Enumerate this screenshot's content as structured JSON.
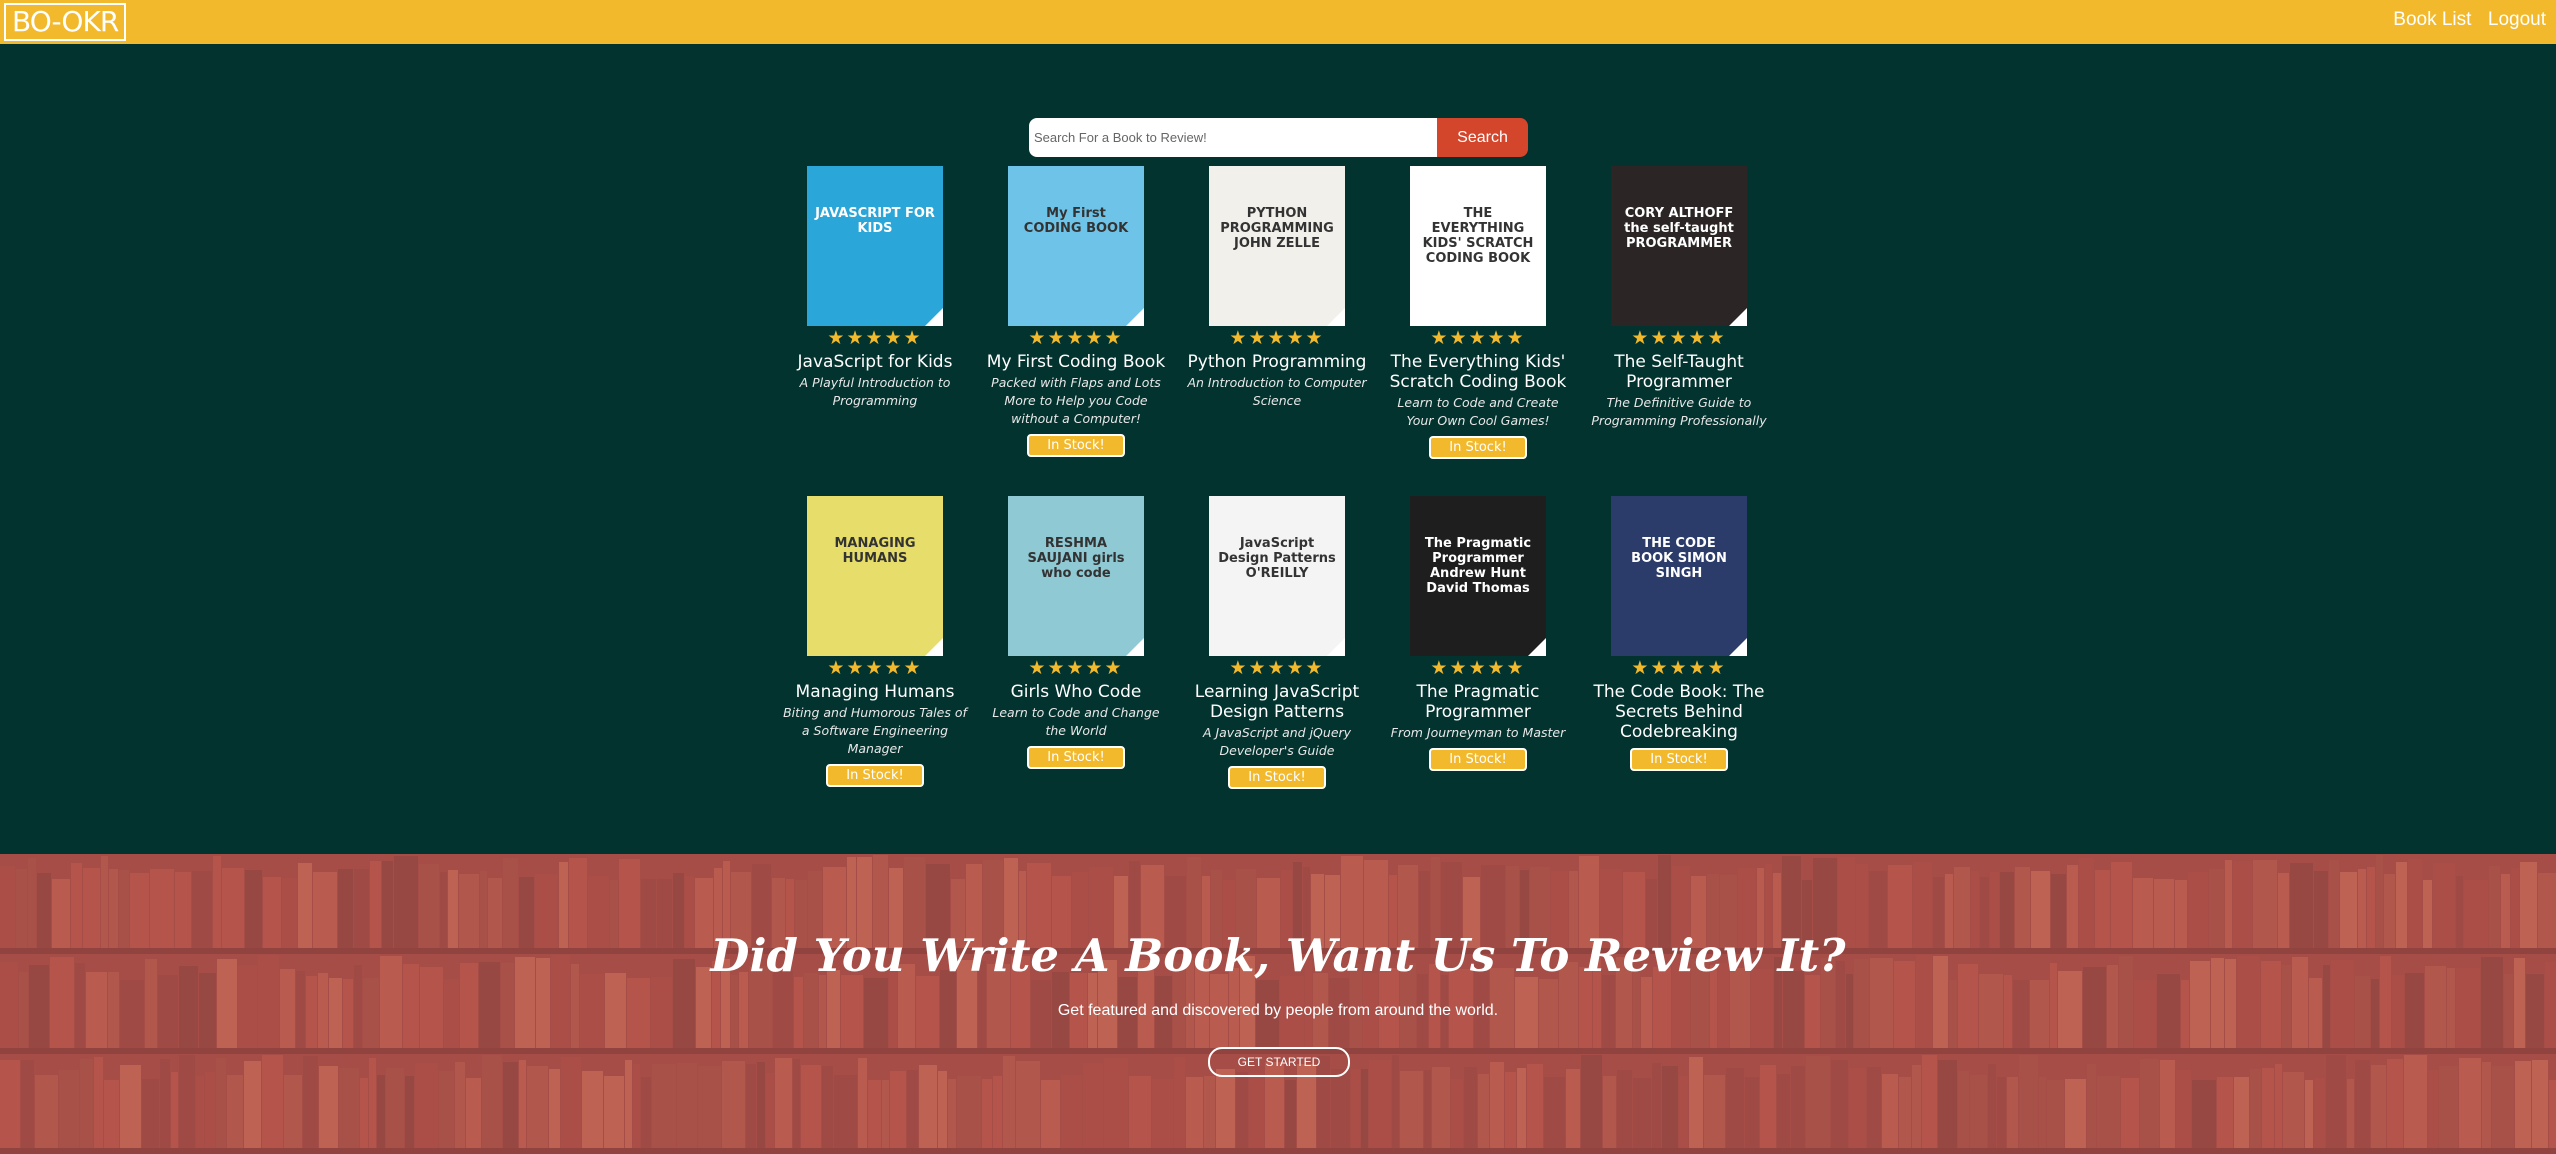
{
  "navbar": {
    "logo": "BO-OKR",
    "links": [
      "Book List",
      "Logout"
    ],
    "color": "#f2b92c"
  },
  "search": {
    "placeholder": "Search For a Book to Review!",
    "button": "Search"
  },
  "books": [
    {
      "title": "JavaScript for Kids",
      "subtitle": "A Playful Introduction to Programming",
      "stars": "★★★★★",
      "stock": ""
    },
    {
      "title": "My First Coding Book",
      "subtitle": "Packed with Flaps and Lots More to Help you Code without a Computer!",
      "stars": "★★★★★",
      "stock": "In Stock!"
    },
    {
      "title": "Python Programming",
      "subtitle": "An Introduction to Computer Science",
      "stars": "★★★★★",
      "stock": ""
    },
    {
      "title": "The Everything Kids' Scratch Coding Book",
      "subtitle": "Learn to Code and Create Your Own Cool Games!",
      "stars": "★★★★★",
      "stock": "In Stock!"
    },
    {
      "title": "The Self-Taught Programmer",
      "subtitle": "The Definitive Guide to Programming Professionally",
      "stars": "★★★★★",
      "stock": ""
    },
    {
      "title": "Managing Humans",
      "subtitle": "Biting and Humorous Tales of a Software Engineering Manager",
      "stars": "★★★★★",
      "stock": "In Stock!"
    },
    {
      "title": "Girls Who Code",
      "subtitle": "Learn to Code and Change the World",
      "stars": "★★★★★",
      "stock": "In Stock!"
    },
    {
      "title": "Learning JavaScript Design Patterns",
      "subtitle": "A JavaScript and jQuery Developer's Guide",
      "stars": "★★★★★",
      "stock": "In Stock!"
    },
    {
      "title": "The Pragmatic Programmer",
      "subtitle": "From Journeyman to Master",
      "stars": "★★★★★",
      "stock": "In Stock!"
    },
    {
      "title": "The Code Book: The Secrets Behind Codebreaking",
      "subtitle": "",
      "stars": "★★★★★",
      "stock": "In Stock!"
    }
  ],
  "covers": [
    {
      "bg": "#2aa6d8",
      "text": "JAVASCRIPT FOR KIDS"
    },
    {
      "bg": "#6ec4e8",
      "text": "My First CODING BOOK"
    },
    {
      "bg": "#f2f0ea",
      "text": "PYTHON PROGRAMMING JOHN ZELLE"
    },
    {
      "bg": "#ffffff",
      "text": "THE EVERYTHING KIDS' SCRATCH CODING BOOK"
    },
    {
      "bg": "#2b2625",
      "text": "CORY ALTHOFF the self-taught PROGRAMMER"
    },
    {
      "bg": "#e6dd6a",
      "text": "MANAGING HUMANS"
    },
    {
      "bg": "#8fc9d4",
      "text": "RESHMA SAUJANI girls who code"
    },
    {
      "bg": "#f4f4f4",
      "text": "JavaScript Design Patterns O'REILLY"
    },
    {
      "bg": "#1e1e1e",
      "text": "The Pragmatic Programmer Andrew Hunt David Thomas"
    },
    {
      "bg": "#2b3b6a",
      "text": "THE CODE BOOK SIMON SINGH"
    }
  ],
  "banner": {
    "title": "Did You Write A Book, Want Us To Review It?",
    "subtitle": "Get featured and discovered by people from around the world.",
    "button": "GET STARTED"
  }
}
